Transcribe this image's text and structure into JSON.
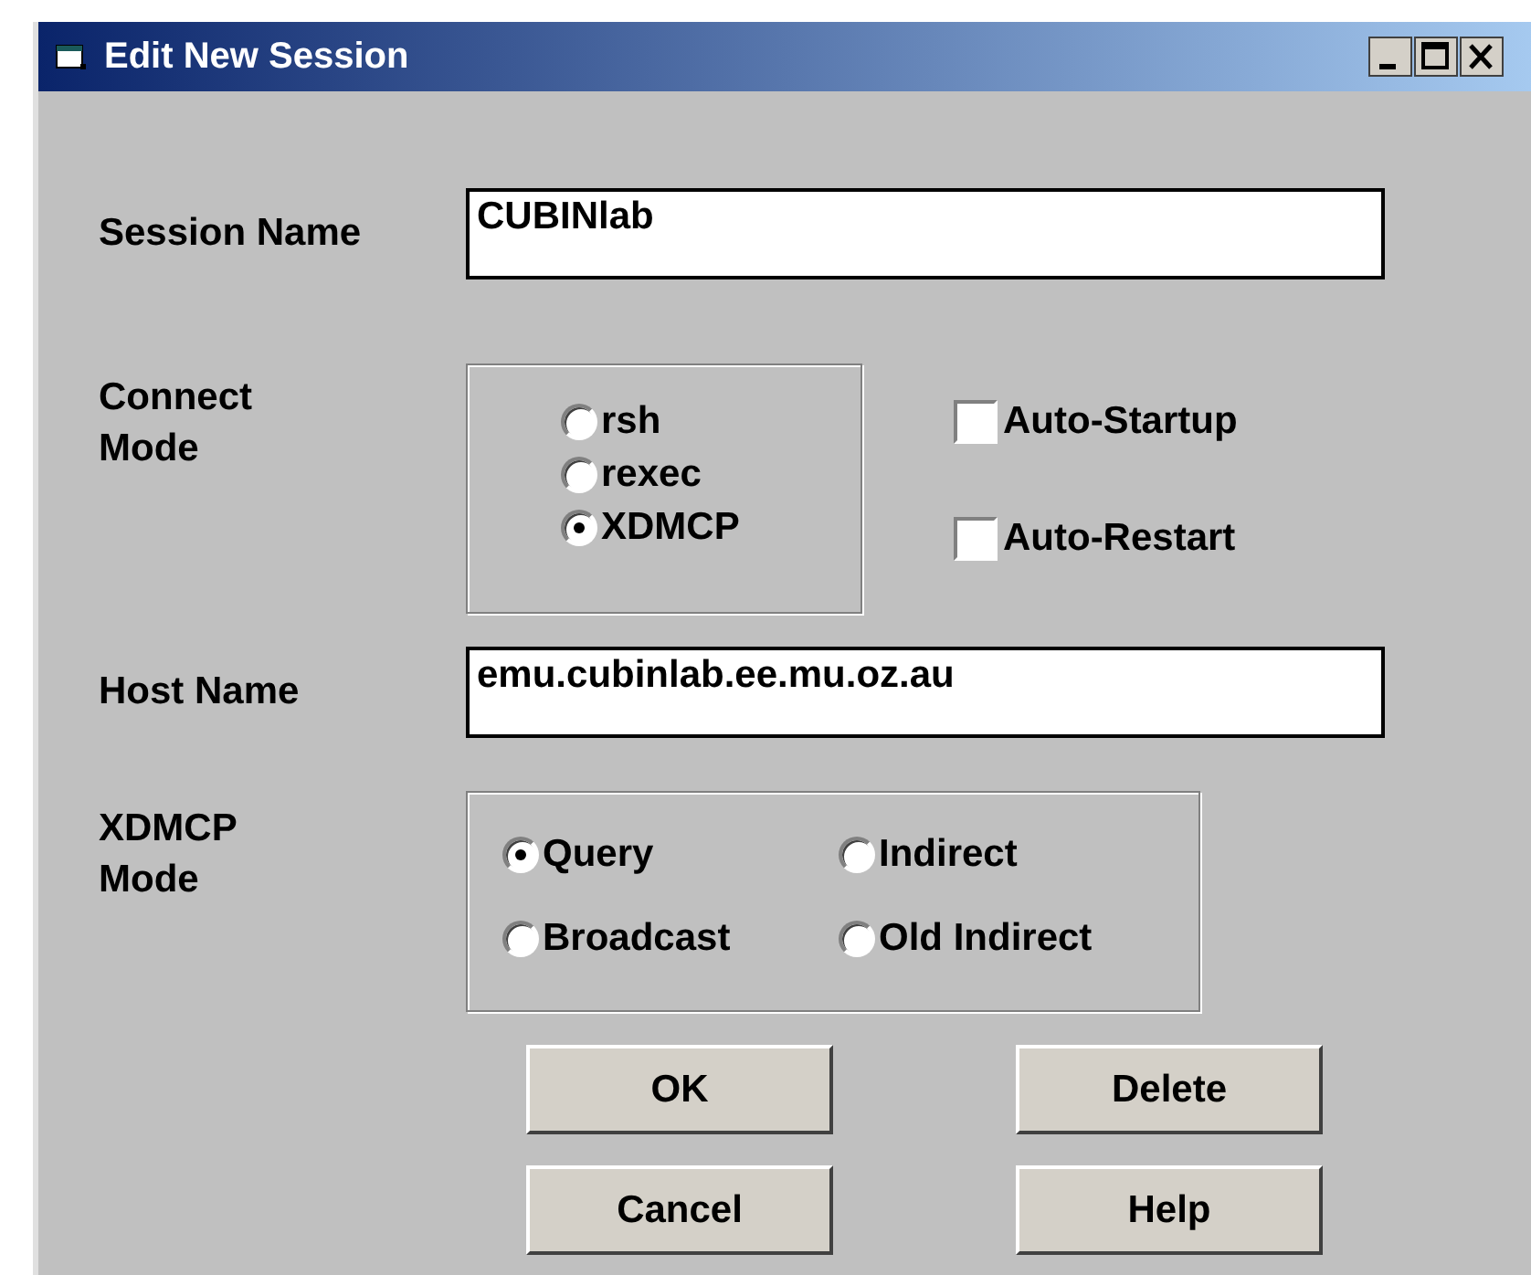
{
  "window": {
    "title": "Edit New Session"
  },
  "session_name": {
    "label": "Session Name",
    "value": "CUBINlab"
  },
  "connect_mode": {
    "label": "Connect Mode",
    "options": [
      {
        "label": "rsh",
        "selected": false
      },
      {
        "label": "rexec",
        "selected": false
      },
      {
        "label": "XDMCP",
        "selected": true
      }
    ]
  },
  "checkboxes": [
    {
      "label": "Auto-Startup",
      "checked": false
    },
    {
      "label": "Auto-Restart",
      "checked": false
    }
  ],
  "host_name": {
    "label": "Host Name",
    "value": "emu.cubinlab.ee.mu.oz.au"
  },
  "xdmcp_mode": {
    "label": "XDMCP Mode",
    "options": [
      {
        "label": "Query",
        "selected": true
      },
      {
        "label": "Indirect",
        "selected": false
      },
      {
        "label": "Broadcast",
        "selected": false
      },
      {
        "label": "Old Indirect",
        "selected": false
      }
    ]
  },
  "buttons": [
    "OK",
    "Delete",
    "Cancel",
    "Help"
  ]
}
